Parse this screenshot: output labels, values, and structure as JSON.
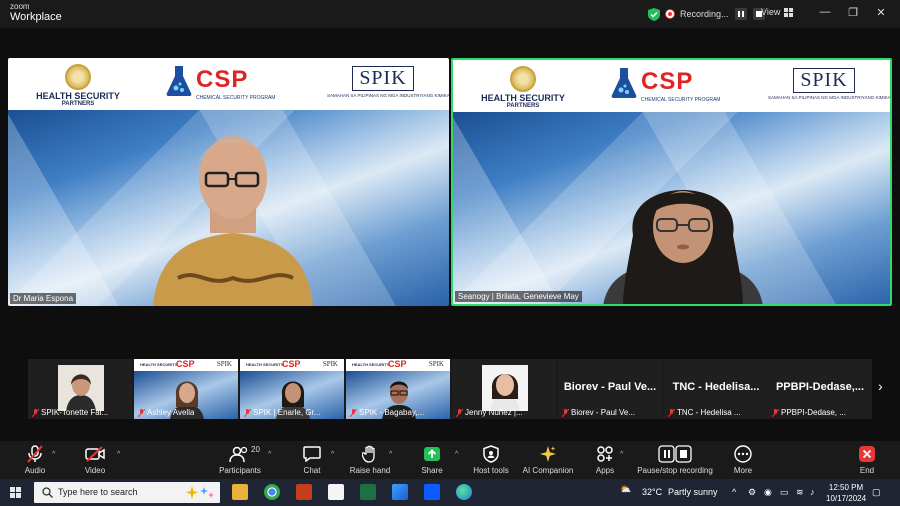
{
  "app": {
    "brand_line1": "zoom",
    "brand_line2": "Workplace"
  },
  "recording": {
    "status": "Recording..."
  },
  "view": {
    "label": "View"
  },
  "banner": {
    "hsp_line1": "HEALTH SECURITY",
    "hsp_line2": "PARTNERS",
    "csp_big": "CSP",
    "csp_small": "CHEMICAL SECURITY PROGRAM",
    "spik_logo": "SPIK",
    "spik_small": "SAMAHAN SA PILIPINAS NG MGA INDUSTRIYANG KIMIKA · CHEMICAL INDUSTRIES ASSOCIATION OF THE PHILIPPINES"
  },
  "tiles": [
    {
      "name": "Dr Maria Espona"
    },
    {
      "name": "Seanogy | Brilata, Genevieve May"
    }
  ],
  "thumbnails": [
    {
      "name": "SPIK-Tonette Fal..."
    },
    {
      "name": "Ashley Avella"
    },
    {
      "name": "SPIK | Enarle, Gr..."
    },
    {
      "name": "SPIK - Bagabay,..."
    },
    {
      "name": "Jenny Nuñez |..."
    },
    {
      "title": "Biorev - Paul Ve...",
      "name": "Biorev - Paul Ve..."
    },
    {
      "title": "TNC - Hedelisa...",
      "name": "TNC - Hedelisa ..."
    },
    {
      "title": "PPBPI-Dedase,...",
      "name": "PPBPI-Dedase, ..."
    }
  ],
  "toolbar": {
    "audio": "Audio",
    "video": "Video",
    "participants": "Participants",
    "participants_count": "20",
    "chat": "Chat",
    "raise_hand": "Raise hand",
    "share": "Share",
    "host_tools": "Host tools",
    "ai_companion": "AI Companion",
    "apps": "Apps",
    "pause_stop": "Pause/stop recording",
    "more": "More",
    "end": "End"
  },
  "taskbar": {
    "search_placeholder": "Type here to search",
    "temperature": "32°C",
    "weather": "Partly sunny",
    "time": "12:50 PM",
    "date": "10/17/2024"
  },
  "colors": {
    "active_speaker": "#2fd96a",
    "end_red": "#e53935",
    "share_green": "#23c05a"
  }
}
